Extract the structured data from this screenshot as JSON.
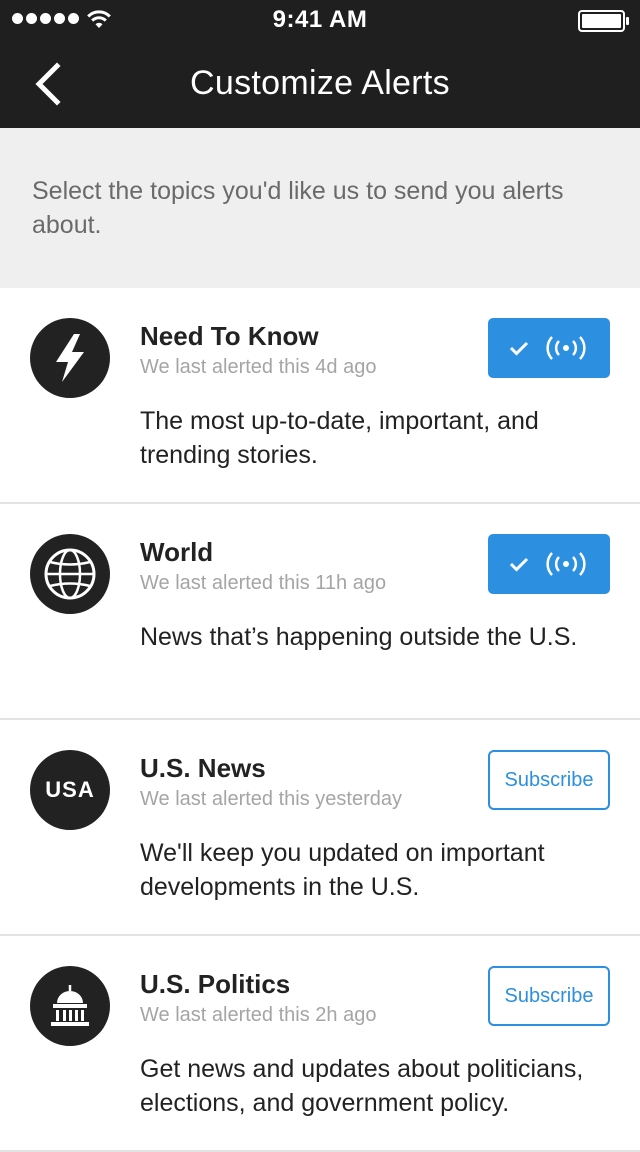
{
  "status_bar": {
    "time": "9:41 AM",
    "signal_icon": "signal-dots-icon",
    "wifi_icon": "wifi-icon",
    "battery_icon": "battery-icon"
  },
  "nav": {
    "title": "Customize Alerts",
    "back_icon": "chevron-left-icon"
  },
  "intro": {
    "text": "Select the topics you'd like us to send you alerts about."
  },
  "colors": {
    "header_bg": "#1f1f1f",
    "accent": "#2d8fdf",
    "intro_bg": "#efefef"
  },
  "topics": [
    {
      "name": "Need To Know",
      "meta": "We last alerted this 4d ago",
      "description": "The most up-to-date, important, and trending stories.",
      "icon": "lightning-icon",
      "subscribed": true
    },
    {
      "name": "World",
      "meta": "We last alerted this 11h ago",
      "description": "News that’s happening outside the U.S.",
      "icon": "globe-icon",
      "subscribed": true
    },
    {
      "name": "U.S. News",
      "meta": "We last alerted this yesterday",
      "description": "We'll keep you updated on important developments in the U.S.",
      "icon": "usa-badge-icon",
      "icon_text": "USA",
      "subscribed": false,
      "button_label": "Subscribe"
    },
    {
      "name": "U.S. Politics",
      "meta": "We last alerted this 2h ago",
      "description": "Get news and updates about politicians, elections, and government policy.",
      "icon": "capitol-icon",
      "subscribed": false,
      "button_label": "Subscribe"
    }
  ]
}
